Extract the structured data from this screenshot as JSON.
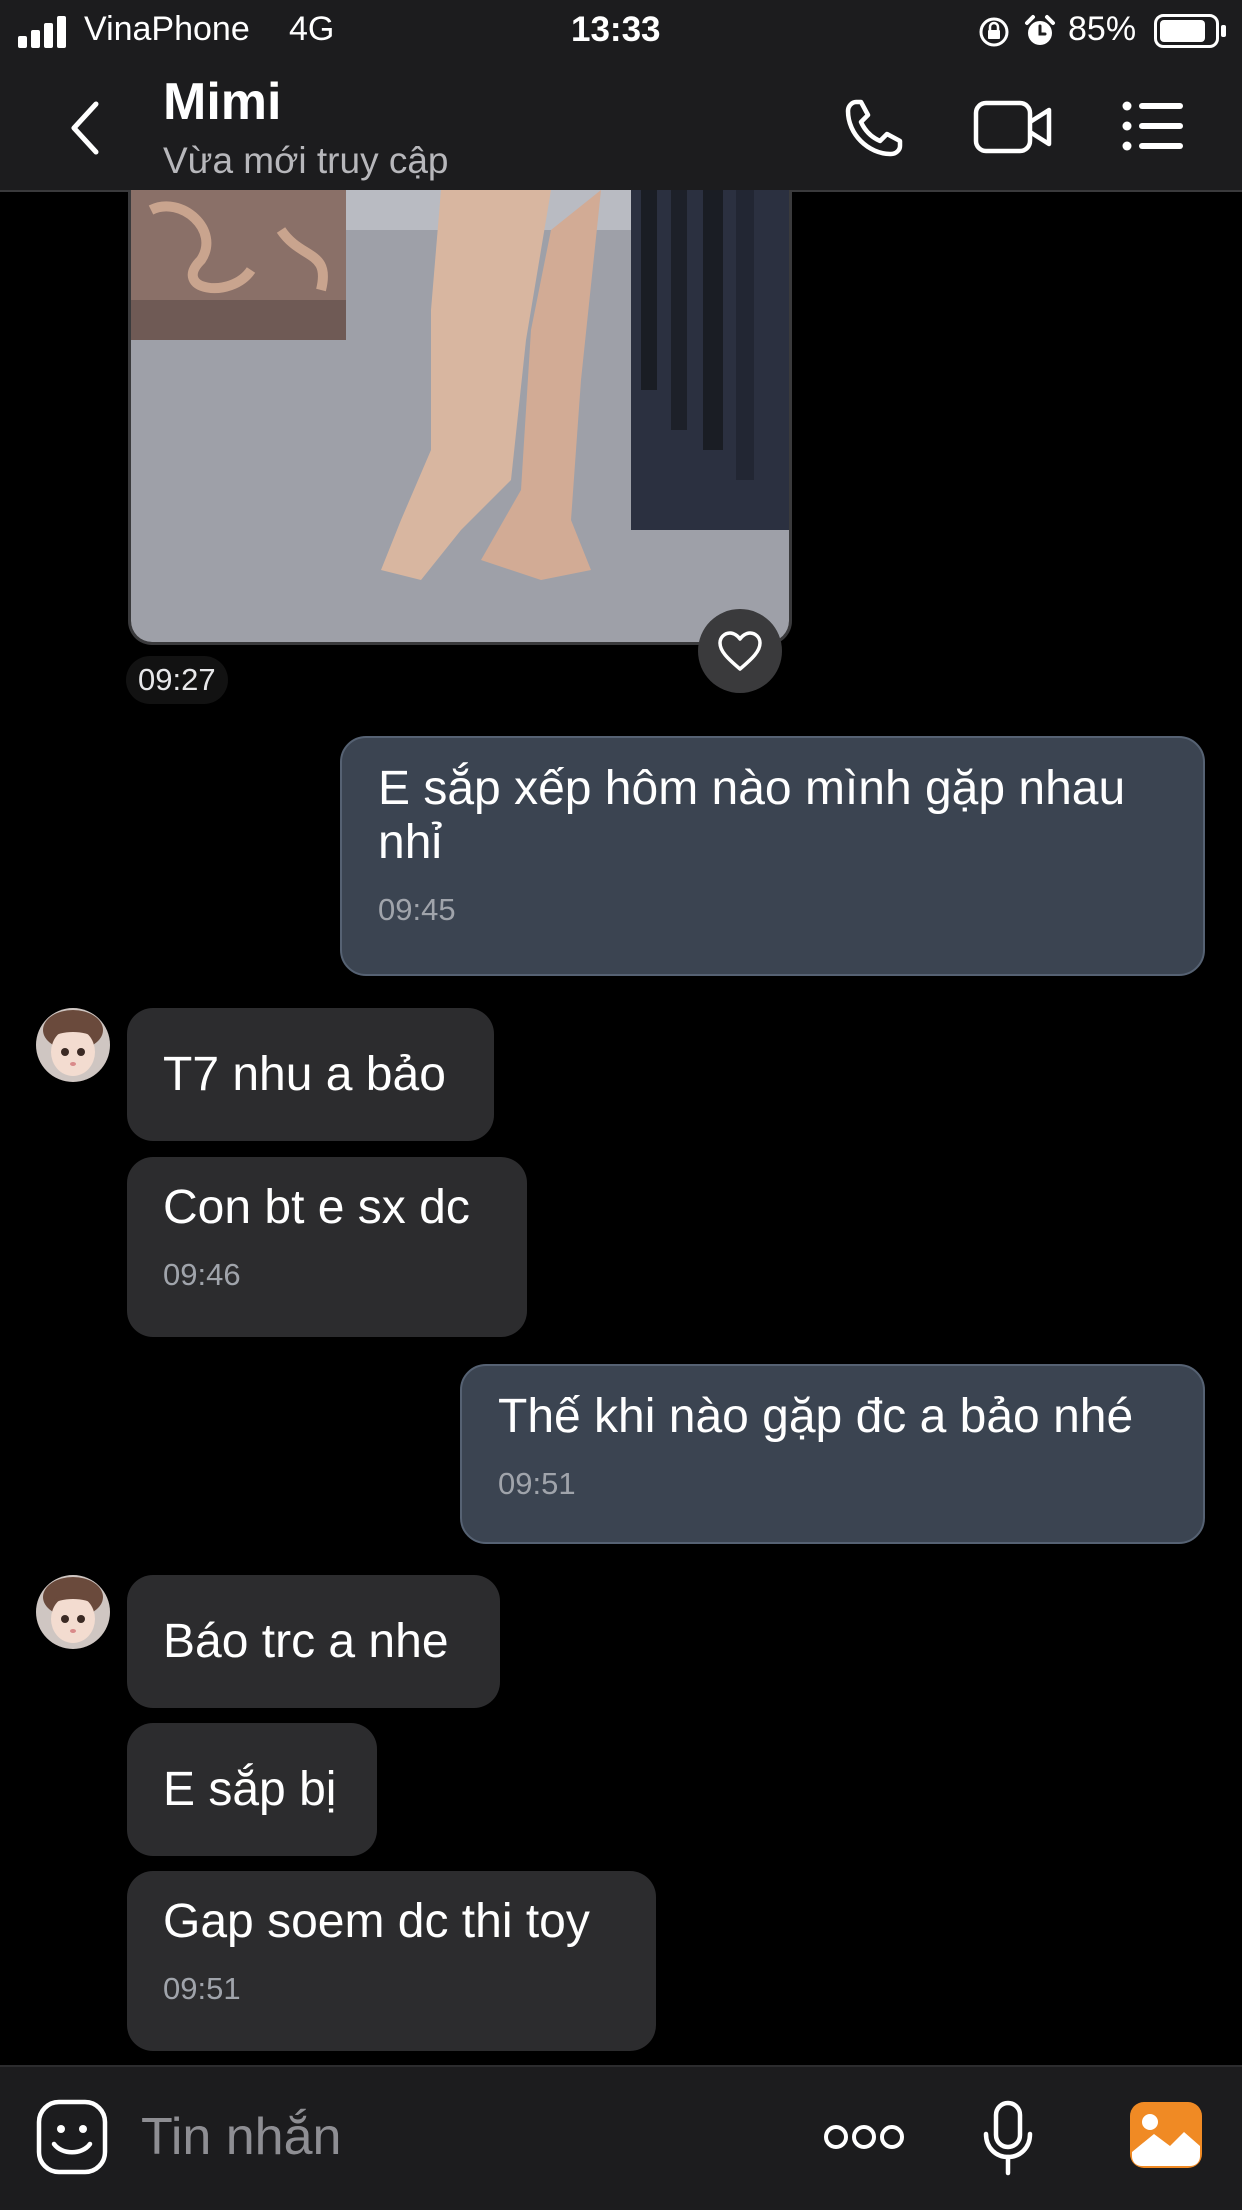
{
  "status_bar": {
    "carrier": "VinaPhone",
    "network": "4G",
    "time": "13:33",
    "battery": "85%",
    "battery_level": 0.85,
    "icons": [
      "signal-icon",
      "orientation-lock-icon",
      "alarm-icon",
      "battery-icon"
    ]
  },
  "header": {
    "contact_name": "Mimi",
    "status": "Vừa mới truy cập",
    "icons": [
      "back-icon",
      "phone-icon",
      "video-call-icon",
      "menu-list-icon"
    ]
  },
  "messages": {
    "photo_time": "09:27",
    "m1": {
      "text": "E sắp xếp hôm nào mình gặp nhau nhỉ",
      "time": "09:45"
    },
    "m2": {
      "text": "T7 nhu a bảo"
    },
    "m3": {
      "text": "Con bt e sx dc",
      "time": "09:46"
    },
    "m4": {
      "text": "Thế khi nào gặp đc a bảo nhé",
      "time": "09:51"
    },
    "m5": {
      "text": "Báo trc a nhe"
    },
    "m6": {
      "text": "E sắp bị"
    },
    "m7": {
      "text": "Gap soem dc thi toy",
      "time": "09:51"
    }
  },
  "input_bar": {
    "placeholder": "Tin nhắn",
    "icons": [
      "sticker-icon",
      "more-icon",
      "microphone-icon",
      "gallery-icon"
    ]
  },
  "colors": {
    "background": "#000000",
    "bar": "#1c1c1e",
    "sent_bubble": "#3b4451",
    "received_bubble": "#2c2c2e",
    "gallery_accent": "#f08a24"
  }
}
